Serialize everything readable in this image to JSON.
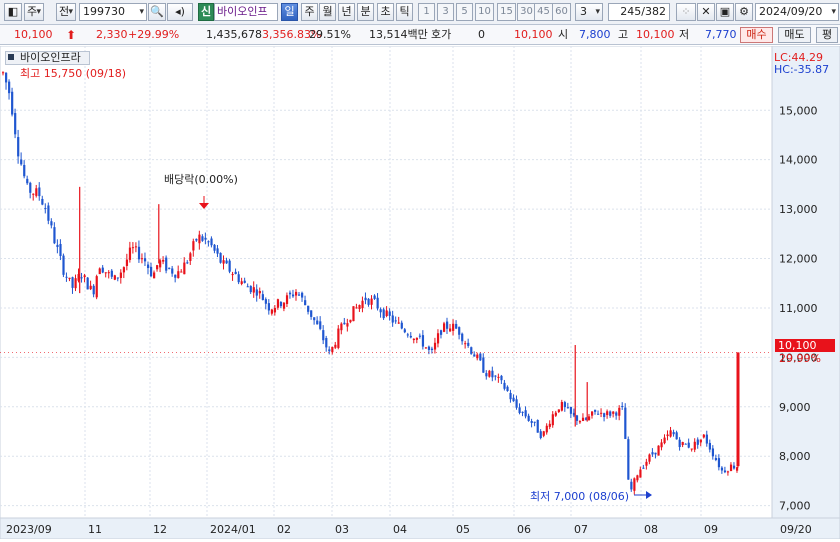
{
  "toolbar": {
    "type_label": "주",
    "type2_label": "전",
    "code": "199730",
    "badge_new": "신",
    "stock_name": "바이오인프",
    "periods": [
      "일",
      "주",
      "월",
      "년",
      "분",
      "초",
      "틱"
    ],
    "active_period": "일",
    "period_numbers": [
      "1",
      "3",
      "5",
      "10",
      "15",
      "30",
      "45",
      "60"
    ],
    "count_select": "3",
    "page_counter": "245/382",
    "date": "2024/09/20"
  },
  "quote": {
    "price": "10,100",
    "change": "2,330",
    "change_pct": "+29.99%",
    "volume": "1,435,678",
    "volume_ratio": "3,356.83%",
    "turnover": "29.51%",
    "amount": "13,514백만",
    "bid_label": "호가",
    "bid_value": "0",
    "ask_value": "10,100",
    "open_label": "시",
    "open": "7,800",
    "high_label": "고",
    "high": "10,100",
    "low_label": "저",
    "low": "7,770",
    "buy_label": "매수",
    "sell_label": "매도",
    "eval_label": "평"
  },
  "chart_panel": {
    "title": "바이오인프라",
    "high_note": "최고 15,750 (09/18)",
    "low_note": "최저 7,000 (08/06)",
    "dividend_note": "배당락(0.00%)",
    "lc_label": "LC:44.29",
    "hc_label": "HC:-35.87",
    "current_price_tag": "10,100",
    "current_pct_tag": "29.99%"
  },
  "chart_data": {
    "type": "candlestick",
    "ylim": [
      6750,
      16300
    ],
    "y_ticks": [
      7000,
      8000,
      9000,
      10000,
      11000,
      12000,
      13000,
      14000,
      15000
    ],
    "y_tick_labels": [
      "7,000",
      "8,000",
      "9,000",
      "10,000",
      "11,000",
      "12,000",
      "13,000",
      "14,000",
      "15,000"
    ],
    "x_tick_labels": [
      "2023/09",
      "11",
      "12",
      "2024/01",
      "02",
      "03",
      "04",
      "05",
      "06",
      "07",
      "08",
      "09",
      "09/20"
    ],
    "colors": {
      "up": "#e8121b",
      "down": "#1f56d0",
      "marker": "#1c3fcf"
    },
    "anchors": [
      {
        "t": 0.0,
        "p": 15750
      },
      {
        "t": 0.012,
        "p": 15300
      },
      {
        "t": 0.025,
        "p": 14200
      },
      {
        "t": 0.04,
        "p": 13400
      },
      {
        "t": 0.06,
        "p": 13300
      },
      {
        "t": 0.07,
        "p": 13050
      },
      {
        "t": 0.085,
        "p": 12400
      },
      {
        "t": 0.1,
        "p": 11800
      },
      {
        "t": 0.115,
        "p": 11400
      },
      {
        "t": 0.13,
        "p": 11700
      },
      {
        "t": 0.15,
        "p": 11300
      },
      {
        "t": 0.16,
        "p": 11900
      },
      {
        "t": 0.185,
        "p": 11550
      },
      {
        "t": 0.2,
        "p": 11800
      },
      {
        "t": 0.215,
        "p": 12200
      },
      {
        "t": 0.235,
        "p": 12000
      },
      {
        "t": 0.25,
        "p": 11650
      },
      {
        "t": 0.26,
        "p": 11950
      },
      {
        "t": 0.275,
        "p": 11800
      },
      {
        "t": 0.29,
        "p": 11700
      },
      {
        "t": 0.305,
        "p": 11900
      },
      {
        "t": 0.325,
        "p": 12450
      },
      {
        "t": 0.345,
        "p": 12300
      },
      {
        "t": 0.365,
        "p": 11900
      },
      {
        "t": 0.385,
        "p": 11700
      },
      {
        "t": 0.405,
        "p": 11450
      },
      {
        "t": 0.425,
        "p": 11350
      },
      {
        "t": 0.445,
        "p": 11000
      },
      {
        "t": 0.47,
        "p": 11150
      },
      {
        "t": 0.49,
        "p": 11350
      },
      {
        "t": 0.51,
        "p": 10950
      },
      {
        "t": 0.53,
        "p": 10500
      },
      {
        "t": 0.545,
        "p": 10050
      },
      {
        "t": 0.56,
        "p": 10500
      },
      {
        "t": 0.575,
        "p": 10800
      },
      {
        "t": 0.59,
        "p": 11000
      },
      {
        "t": 0.605,
        "p": 11200
      },
      {
        "t": 0.62,
        "p": 11100
      },
      {
        "t": 0.635,
        "p": 10900
      },
      {
        "t": 0.65,
        "p": 10750
      },
      {
        "t": 0.665,
        "p": 10600
      },
      {
        "t": 0.685,
        "p": 10450
      },
      {
        "t": 0.7,
        "p": 10300
      },
      {
        "t": 0.715,
        "p": 10050
      },
      {
        "t": 0.73,
        "p": 10550
      },
      {
        "t": 0.745,
        "p": 10650
      },
      {
        "t": 0.76,
        "p": 10550
      },
      {
        "t": 0.775,
        "p": 10250
      },
      {
        "t": 0.79,
        "p": 10000
      },
      {
        "t": 0.805,
        "p": 9700
      },
      {
        "t": 0.825,
        "p": 9550
      },
      {
        "t": 0.84,
        "p": 9350
      },
      {
        "t": 0.855,
        "p": 9000
      },
      {
        "t": 0.87,
        "p": 8850
      },
      {
        "t": 0.885,
        "p": 8650
      },
      {
        "t": 0.9,
        "p": 8400
      },
      {
        "t": 0.915,
        "p": 8800
      },
      {
        "t": 0.93,
        "p": 9050
      },
      {
        "t": 0.95,
        "p": 8800
      },
      {
        "t": 0.97,
        "p": 8700
      },
      {
        "t": 0.99,
        "p": 8900
      },
      {
        "t": 1.01,
        "p": 8850
      },
      {
        "t": 1.035,
        "p": 8950
      },
      {
        "t": 1.045,
        "p": 7200
      },
      {
        "t": 1.06,
        "p": 7700
      },
      {
        "t": 1.08,
        "p": 8000
      },
      {
        "t": 1.1,
        "p": 8250
      },
      {
        "t": 1.115,
        "p": 8500
      },
      {
        "t": 1.13,
        "p": 8250
      },
      {
        "t": 1.15,
        "p": 8200
      },
      {
        "t": 1.17,
        "p": 8400
      },
      {
        "t": 1.185,
        "p": 8050
      },
      {
        "t": 1.2,
        "p": 7700
      },
      {
        "t": 1.215,
        "p": 7800
      },
      {
        "t": 1.23,
        "p": 7800
      }
    ],
    "series_start_t": 0.0,
    "last_candle": {
      "open": 7800,
      "high": 10100,
      "low": 7770,
      "close": 10100
    }
  }
}
